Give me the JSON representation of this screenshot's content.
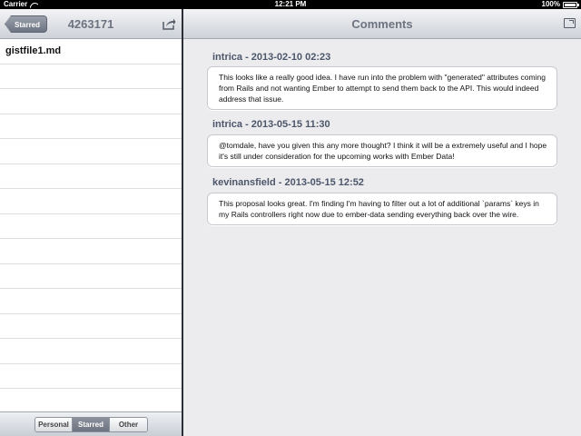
{
  "status_bar": {
    "carrier": "Carrier",
    "time": "12:21 PM",
    "battery": "100%"
  },
  "left_panel": {
    "back_label": "Starred",
    "title": "4263171",
    "files": [
      "gistfile1.md"
    ],
    "segments": [
      {
        "label": "Personal",
        "active": false
      },
      {
        "label": "Starred",
        "active": true
      },
      {
        "label": "Other",
        "active": false
      }
    ]
  },
  "right_panel": {
    "title": "Comments",
    "comments": [
      {
        "author": "intrica - 2013-02-10 02:23",
        "body": "This looks like a really good idea. I have run into the problem with \"generated\" attributes coming from Rails and not wanting Ember to attempt to send them back to the API. This would indeed address that issue."
      },
      {
        "author": "intrica - 2013-05-15 11:30",
        "body": "@tomdale, have you given this any more thought? I think it will be a extremely useful and I hope it's still under consideration for the upcoming works with Ember Data!"
      },
      {
        "author": "kevinansfield - 2013-05-15 12:52",
        "body": "This proposal looks great. I'm finding I'm having to filter out a lot of additional `params` keys in my Rails controllers right now due to ember-data sending everything back over the wire."
      }
    ]
  },
  "icons": {
    "wifi": "wifi-icon",
    "battery": "battery-icon",
    "share": "share-icon",
    "fullscreen": "fullscreen-icon"
  }
}
